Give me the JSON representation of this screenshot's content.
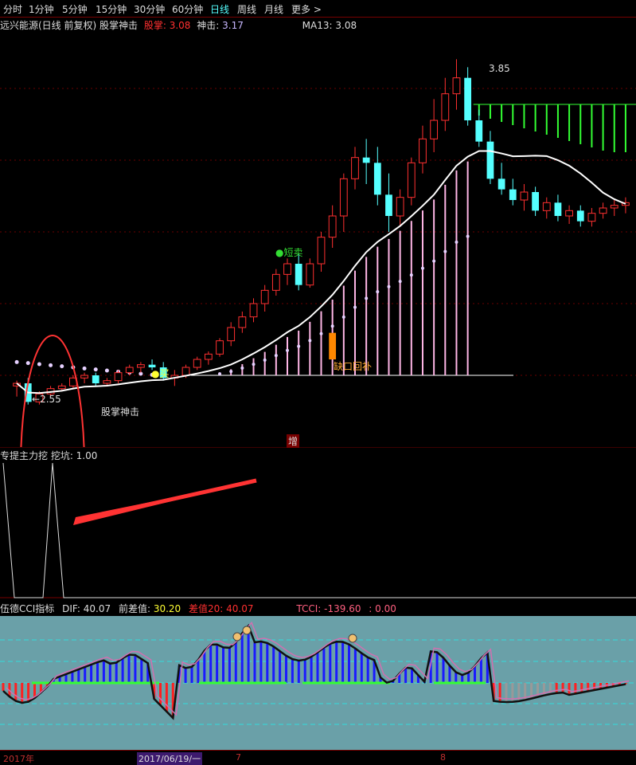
{
  "toolbar": {
    "tabs": [
      {
        "label": "分时",
        "active": false
      },
      {
        "label": "1分钟",
        "active": false
      },
      {
        "label": "5分钟",
        "active": false
      },
      {
        "label": "15分钟",
        "active": false
      },
      {
        "label": "30分钟",
        "active": false
      },
      {
        "label": "60分钟",
        "active": false
      },
      {
        "label": "日线",
        "active": true
      },
      {
        "label": "周线",
        "active": false
      },
      {
        "label": "月线",
        "active": false
      },
      {
        "label": "更多 >",
        "active": false
      }
    ]
  },
  "main_legend": {
    "stock_title": "远兴能源(日线 前复权) 股掌神击",
    "guzhang_label": "股掌:",
    "guzhang_value": "3.08",
    "shenji_label": "神击:",
    "shenji_value": "3.17",
    "ma13_label": "MA13:",
    "ma13_value": "3.08"
  },
  "annotations": {
    "high_price": "3.85",
    "low_price": "2.55",
    "short_sell": "●短卖",
    "gap_fill": "缺口回补",
    "indicator_name": "股掌神击",
    "buy_signal": "●买",
    "zeng": "增"
  },
  "sub_legend": {
    "text": "专提主力挖 挖坑: 1.00"
  },
  "cci_legend": {
    "name": "伍德CCI指标",
    "dif": "DIF: 40.07",
    "qianchazhi_label": "前差值:",
    "qianchazhi_value": "30.20",
    "chazhi_label": "差值20:",
    "chazhi_value": "40.07",
    "tcci_label": "TCCI:",
    "tcci_value": "-139.60",
    "last_value": ": 0.00"
  },
  "time_axis": {
    "labels": [
      "2017年",
      "2017/06/19/一",
      "7",
      "8"
    ]
  },
  "colors": {
    "up": "#ff3030",
    "down": "#55ffff",
    "ma": "#ffffff",
    "pink": "#ffb6e6",
    "green": "#33ff33",
    "cci_bg": "#6aa0a8",
    "cci_blue": "#1a1aff"
  },
  "chart_data": {
    "type": "candlestick",
    "candles": [
      {
        "o": 2.62,
        "h": 2.64,
        "l": 2.58,
        "c": 2.63
      },
      {
        "o": 2.63,
        "h": 2.65,
        "l": 2.55,
        "c": 2.56
      },
      {
        "o": 2.56,
        "h": 2.6,
        "l": 2.55,
        "c": 2.59
      },
      {
        "o": 2.59,
        "h": 2.62,
        "l": 2.58,
        "c": 2.61
      },
      {
        "o": 2.61,
        "h": 2.63,
        "l": 2.6,
        "c": 2.62
      },
      {
        "o": 2.62,
        "h": 2.66,
        "l": 2.61,
        "c": 2.65
      },
      {
        "o": 2.65,
        "h": 2.67,
        "l": 2.63,
        "c": 2.66
      },
      {
        "o": 2.66,
        "h": 2.67,
        "l": 2.62,
        "c": 2.63
      },
      {
        "o": 2.63,
        "h": 2.65,
        "l": 2.62,
        "c": 2.64
      },
      {
        "o": 2.64,
        "h": 2.68,
        "l": 2.63,
        "c": 2.67
      },
      {
        "o": 2.67,
        "h": 2.7,
        "l": 2.66,
        "c": 2.69
      },
      {
        "o": 2.69,
        "h": 2.71,
        "l": 2.67,
        "c": 2.7
      },
      {
        "o": 2.7,
        "h": 2.72,
        "l": 2.68,
        "c": 2.69
      },
      {
        "o": 2.69,
        "h": 2.71,
        "l": 2.64,
        "c": 2.65
      },
      {
        "o": 2.65,
        "h": 2.68,
        "l": 2.62,
        "c": 2.66
      },
      {
        "o": 2.66,
        "h": 2.7,
        "l": 2.65,
        "c": 2.69
      },
      {
        "o": 2.69,
        "h": 2.73,
        "l": 2.68,
        "c": 2.72
      },
      {
        "o": 2.72,
        "h": 2.75,
        "l": 2.7,
        "c": 2.74
      },
      {
        "o": 2.74,
        "h": 2.8,
        "l": 2.73,
        "c": 2.79
      },
      {
        "o": 2.79,
        "h": 2.86,
        "l": 2.77,
        "c": 2.84
      },
      {
        "o": 2.84,
        "h": 2.9,
        "l": 2.82,
        "c": 2.88
      },
      {
        "o": 2.88,
        "h": 2.95,
        "l": 2.86,
        "c": 2.93
      },
      {
        "o": 2.93,
        "h": 3.0,
        "l": 2.9,
        "c": 2.98
      },
      {
        "o": 2.98,
        "h": 3.06,
        "l": 2.96,
        "c": 3.04
      },
      {
        "o": 3.04,
        "h": 3.1,
        "l": 3.0,
        "c": 3.08
      },
      {
        "o": 3.08,
        "h": 3.12,
        "l": 2.98,
        "c": 3.0
      },
      {
        "o": 3.0,
        "h": 3.1,
        "l": 2.99,
        "c": 3.08
      },
      {
        "o": 3.08,
        "h": 3.2,
        "l": 3.05,
        "c": 3.18
      },
      {
        "o": 3.18,
        "h": 3.3,
        "l": 3.14,
        "c": 3.26
      },
      {
        "o": 3.26,
        "h": 3.42,
        "l": 3.2,
        "c": 3.4
      },
      {
        "o": 3.4,
        "h": 3.52,
        "l": 3.36,
        "c": 3.48
      },
      {
        "o": 3.48,
        "h": 3.55,
        "l": 3.38,
        "c": 3.46
      },
      {
        "o": 3.46,
        "h": 3.52,
        "l": 3.3,
        "c": 3.34
      },
      {
        "o": 3.34,
        "h": 3.42,
        "l": 3.2,
        "c": 3.26
      },
      {
        "o": 3.26,
        "h": 3.36,
        "l": 3.22,
        "c": 3.33
      },
      {
        "o": 3.33,
        "h": 3.48,
        "l": 3.3,
        "c": 3.46
      },
      {
        "o": 3.46,
        "h": 3.6,
        "l": 3.42,
        "c": 3.55
      },
      {
        "o": 3.55,
        "h": 3.7,
        "l": 3.5,
        "c": 3.62
      },
      {
        "o": 3.62,
        "h": 3.78,
        "l": 3.58,
        "c": 3.72
      },
      {
        "o": 3.72,
        "h": 3.85,
        "l": 3.66,
        "c": 3.78
      },
      {
        "o": 3.78,
        "h": 3.82,
        "l": 3.6,
        "c": 3.62
      },
      {
        "o": 3.62,
        "h": 3.66,
        "l": 3.52,
        "c": 3.54
      },
      {
        "o": 3.54,
        "h": 3.58,
        "l": 3.38,
        "c": 3.4
      },
      {
        "o": 3.4,
        "h": 3.46,
        "l": 3.34,
        "c": 3.36
      },
      {
        "o": 3.36,
        "h": 3.4,
        "l": 3.3,
        "c": 3.32
      },
      {
        "o": 3.32,
        "h": 3.38,
        "l": 3.28,
        "c": 3.35
      },
      {
        "o": 3.35,
        "h": 3.37,
        "l": 3.26,
        "c": 3.28
      },
      {
        "o": 3.28,
        "h": 3.33,
        "l": 3.25,
        "c": 3.31
      },
      {
        "o": 3.31,
        "h": 3.34,
        "l": 3.24,
        "c": 3.26
      },
      {
        "o": 3.26,
        "h": 3.3,
        "l": 3.23,
        "c": 3.28
      },
      {
        "o": 3.28,
        "h": 3.3,
        "l": 3.22,
        "c": 3.24
      },
      {
        "o": 3.24,
        "h": 3.29,
        "l": 3.22,
        "c": 3.27
      },
      {
        "o": 3.27,
        "h": 3.31,
        "l": 3.25,
        "c": 3.29
      },
      {
        "o": 3.29,
        "h": 3.32,
        "l": 3.26,
        "c": 3.3
      },
      {
        "o": 3.3,
        "h": 3.33,
        "l": 3.27,
        "c": 3.31
      }
    ],
    "ylim": [
      2.45,
      3.95
    ],
    "xlabel": "",
    "ylabel": ""
  }
}
